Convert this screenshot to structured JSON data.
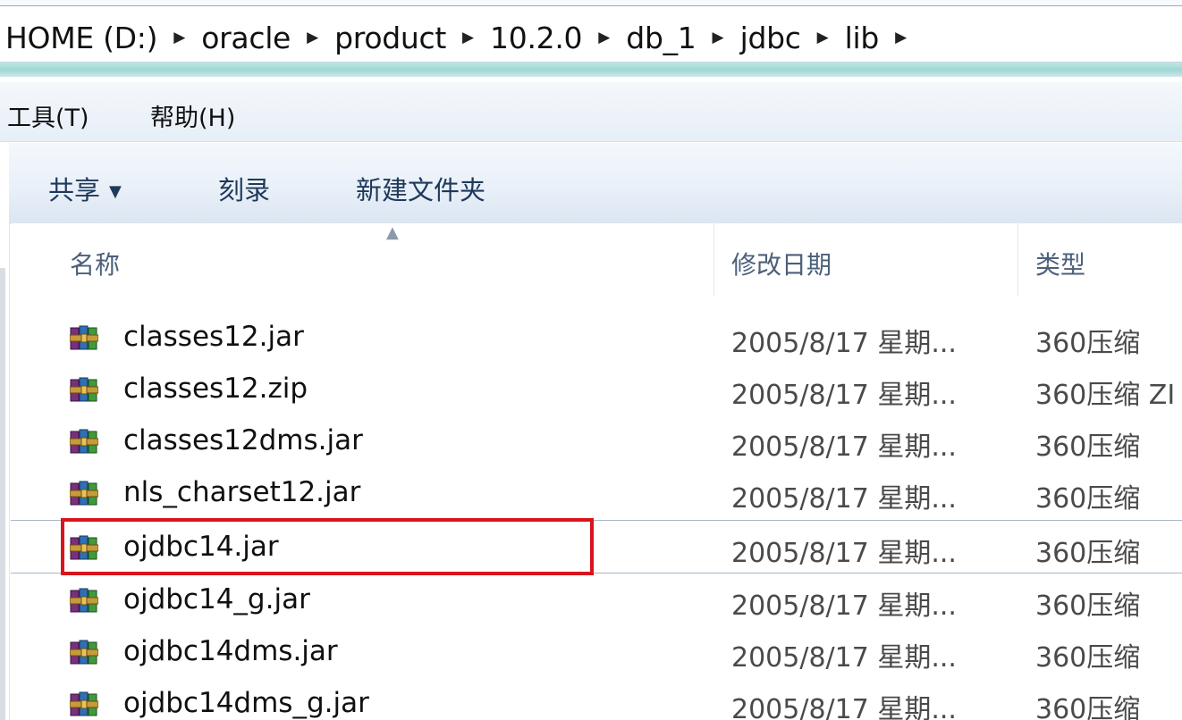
{
  "address": {
    "crumbs": [
      "HOME (D:)",
      "oracle",
      "product",
      "10.2.0",
      "db_1",
      "jdbc",
      "lib"
    ]
  },
  "menu": {
    "tools": "工具(T)",
    "help": "帮助(H)"
  },
  "toolbar": {
    "share": "共享",
    "burn": "刻录",
    "new_folder": "新建文件夹"
  },
  "columns": {
    "name": "名称",
    "date": "修改日期",
    "type": "类型"
  },
  "files": [
    {
      "name": "classes12.jar",
      "date": "2005/8/17 星期...",
      "type": "360压缩"
    },
    {
      "name": "classes12.zip",
      "date": "2005/8/17 星期...",
      "type": "360压缩 ZI"
    },
    {
      "name": "classes12dms.jar",
      "date": "2005/8/17 星期...",
      "type": "360压缩"
    },
    {
      "name": "nls_charset12.jar",
      "date": "2005/8/17 星期...",
      "type": "360压缩"
    },
    {
      "name": "ojdbc14.jar",
      "date": "2005/8/17 星期...",
      "type": "360压缩"
    },
    {
      "name": "ojdbc14_g.jar",
      "date": "2005/8/17 星期...",
      "type": "360压缩"
    },
    {
      "name": "ojdbc14dms.jar",
      "date": "2005/8/17 星期...",
      "type": "360压缩"
    },
    {
      "name": "ojdbc14dms_g.jar",
      "date": "2005/8/17 星期...",
      "type": "360压缩"
    }
  ],
  "colors": {
    "highlight": "#d8151c",
    "header_text": "#4c607a"
  },
  "icons": {
    "file": "winrar-archive-icon",
    "sort": "sort-ascending-icon"
  }
}
